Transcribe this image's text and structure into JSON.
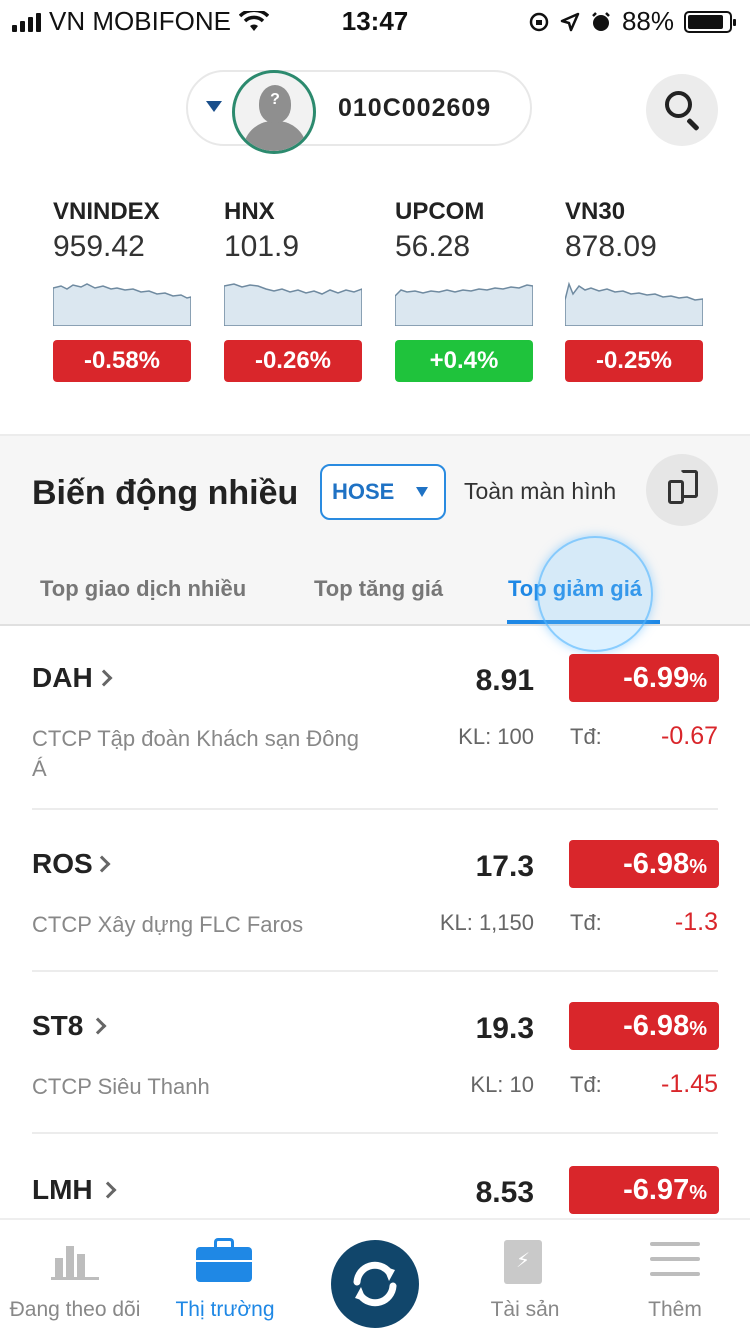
{
  "status_bar": {
    "carrier": "VN MOBIFONE",
    "time": "13:47",
    "battery": "88%",
    "battery_level": 0.88
  },
  "header": {
    "account_id": "010C002609",
    "avatar_text": "?"
  },
  "indices": [
    {
      "name": "VNINDEX",
      "value": "959.42",
      "change": "-0.58%",
      "direction": "down"
    },
    {
      "name": "HNX",
      "value": "101.9",
      "change": "-0.26%",
      "direction": "down"
    },
    {
      "name": "UPCOM",
      "value": "56.28",
      "change": "+0.4%",
      "direction": "up"
    },
    {
      "name": "VN30",
      "value": "878.09",
      "change": "-0.25%",
      "direction": "down"
    }
  ],
  "section": {
    "title": "Biến động nhiều",
    "exchange": "HOSE",
    "fullscreen_label": "Toàn màn hình",
    "tabs": [
      {
        "label": "Top giao dịch nhiều",
        "active": false
      },
      {
        "label": "Top tăng giá",
        "active": false
      },
      {
        "label": "Top giảm giá",
        "active": true
      }
    ]
  },
  "stocks": [
    {
      "symbol": "DAH",
      "company": "CTCP Tập đoàn Khách sạn Đông Á",
      "price": "8.91",
      "volume": "KL: 100",
      "change_pct": "-6.99",
      "pct_sign": "%",
      "td_label": "Tđ:",
      "td": "-0.67"
    },
    {
      "symbol": "ROS",
      "company": "CTCP Xây dựng FLC Faros",
      "price": "17.3",
      "volume": "KL: 1,150",
      "change_pct": "-6.98",
      "pct_sign": "%",
      "td_label": "Tđ:",
      "td": "-1.3"
    },
    {
      "symbol": "ST8",
      "company": "CTCP Siêu Thanh",
      "price": "19.3",
      "volume": "KL: 10",
      "change_pct": "-6.98",
      "pct_sign": "%",
      "td_label": "Tđ:",
      "td": "-1.45"
    },
    {
      "symbol": "LMH",
      "company": "",
      "price": "8.53",
      "volume": "",
      "change_pct": "-6.97",
      "pct_sign": "%",
      "td_label": "",
      "td": ""
    }
  ],
  "nav": [
    {
      "label": "Đang theo dõi",
      "icon": "bar-chart-icon",
      "active": false
    },
    {
      "label": "Thị trường",
      "icon": "briefcase-icon",
      "active": true
    },
    {
      "label": "",
      "icon": "exchange-icon",
      "active": false
    },
    {
      "label": "Tài sản",
      "icon": "wallet-book-icon",
      "active": false
    },
    {
      "label": "Thêm",
      "icon": "menu-icon",
      "active": false
    }
  ],
  "colors": {
    "down": "#d9262b",
    "up": "#1fc33c",
    "accent": "#1f88e5",
    "center_button": "#11466b"
  }
}
